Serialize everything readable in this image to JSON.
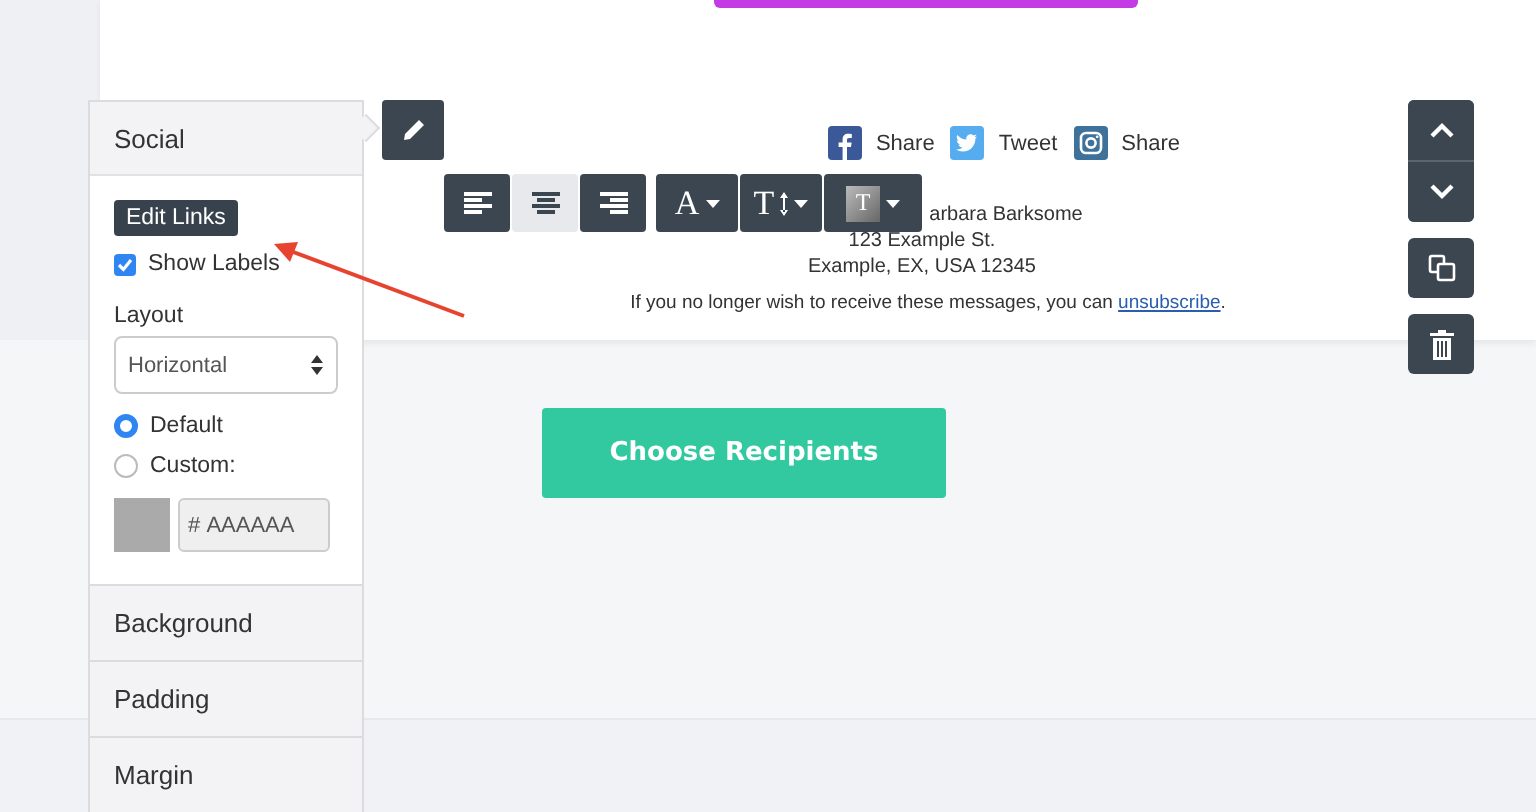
{
  "social_links": [
    {
      "kind": "facebook",
      "label": "Share"
    },
    {
      "kind": "twitter",
      "label": "Tweet"
    },
    {
      "kind": "instagram",
      "label": "Share"
    }
  ],
  "address": {
    "name_line": "arbara Barksome",
    "lines": [
      "123 Example St.",
      "Example, EX, USA 12345"
    ]
  },
  "footer": {
    "text": "If you no longer wish to receive these messages, you can ",
    "link": "unsubscribe",
    "end": "."
  },
  "cta_button": "Choose Recipients",
  "toolbar": {
    "align": [
      {
        "kind": "left",
        "selected": false
      },
      {
        "kind": "center",
        "selected": true
      },
      {
        "kind": "right",
        "selected": false
      }
    ],
    "font_button": "A",
    "size_button": "T",
    "color_button": "T"
  },
  "panel": {
    "title": "Social",
    "edit_button": "Edit Links",
    "show_labels": {
      "label": "Show Labels",
      "checked": true
    },
    "layout_label": "Layout",
    "layout_value": "Horizontal",
    "color_options": [
      {
        "label": "Default",
        "selected": true
      },
      {
        "label": "Custom:",
        "selected": false
      }
    ],
    "hex_prefix": "#",
    "hex_value": "AAAAAA",
    "sections": [
      "Background",
      "Padding",
      "Margin"
    ]
  }
}
